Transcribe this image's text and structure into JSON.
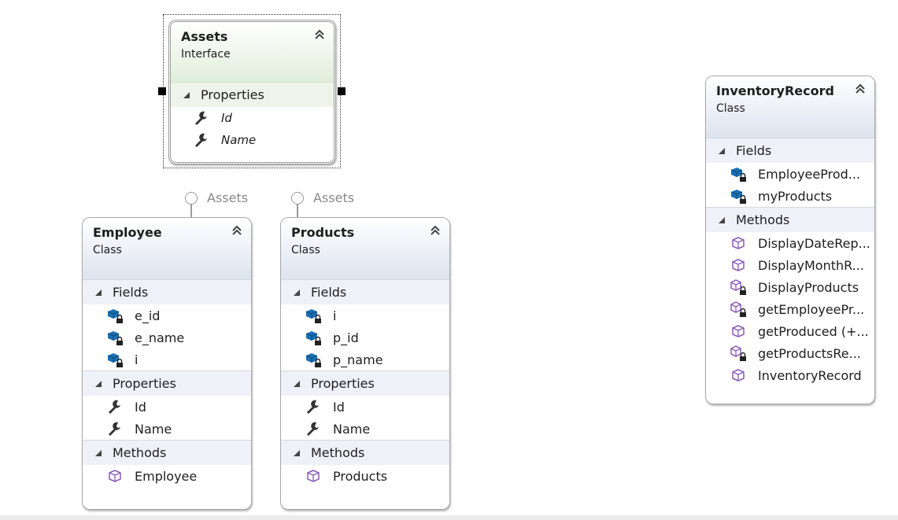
{
  "assets": {
    "name": "Assets",
    "kind": "Interface",
    "sections": {
      "properties": {
        "label": "Properties",
        "items": [
          "Id",
          "Name"
        ]
      }
    }
  },
  "lollipops": [
    "Assets",
    "Assets"
  ],
  "employee": {
    "name": "Employee",
    "kind": "Class",
    "sections": {
      "fields": {
        "label": "Fields",
        "items": [
          "e_id",
          "e_name",
          "i"
        ]
      },
      "properties": {
        "label": "Properties",
        "items": [
          "Id",
          "Name"
        ]
      },
      "methods": {
        "label": "Methods",
        "items": [
          "Employee"
        ]
      }
    }
  },
  "products": {
    "name": "Products",
    "kind": "Class",
    "sections": {
      "fields": {
        "label": "Fields",
        "items": [
          "i",
          "p_id",
          "p_name"
        ]
      },
      "properties": {
        "label": "Properties",
        "items": [
          "Id",
          "Name"
        ]
      },
      "methods": {
        "label": "Methods",
        "items": [
          "Products"
        ]
      }
    }
  },
  "inventory": {
    "name": "InventoryRecord",
    "kind": "Class",
    "sections": {
      "fields": {
        "label": "Fields",
        "items": [
          "EmployeeProd...",
          "myProducts"
        ]
      },
      "methods": {
        "label": "Methods",
        "items": [
          "DisplayDateRep...",
          "DisplayMonthR...",
          "DisplayProducts",
          "getEmployeePr...",
          "getProduced  (+...",
          "getProductsRe...",
          "InventoryRecord"
        ]
      }
    }
  },
  "icons": {
    "collapse": "double-chevron-up-icon",
    "section_toggle": "triangle-expanded-icon",
    "property": "wrench-icon",
    "field_private": "private-field-icon",
    "method_public": "method-icon",
    "method_private": "private-method-icon"
  },
  "colors": {
    "class_header": "#dde3ef",
    "interface_header": "#e1eedb",
    "field_icon": "#1a6fb3",
    "method_icon": "#8a5bb8"
  }
}
